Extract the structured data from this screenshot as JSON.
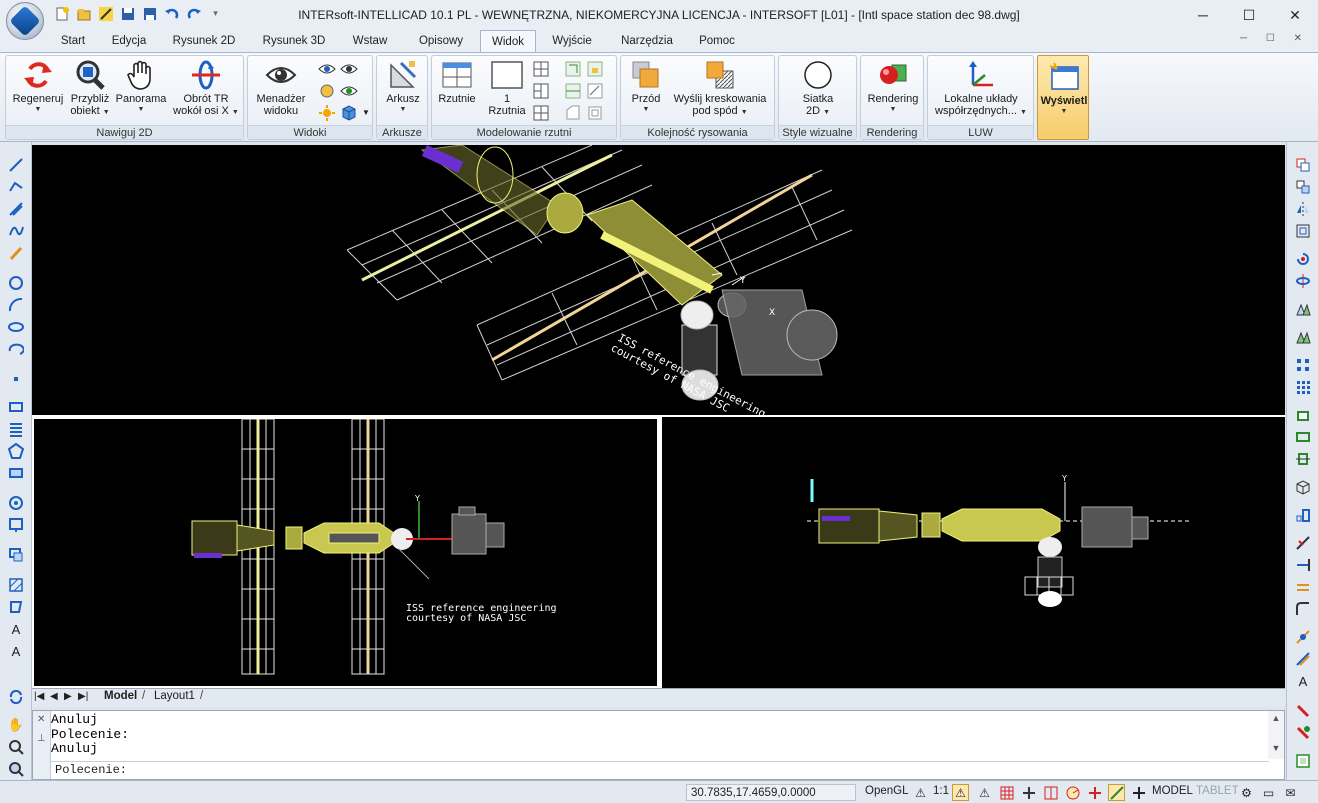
{
  "window": {
    "title": "INTERsoft-INTELLICAD 10.1 PL - WEWNĘTRZNA, NIEKOMERCYJNA LICENCJA - INTERSOFT [L01] - [Intl space station dec 98.dwg]",
    "minimize": "─",
    "maximize": "☐",
    "close": "✕"
  },
  "tabs": [
    {
      "label": "Start"
    },
    {
      "label": "Edycja"
    },
    {
      "label": "Rysunek 2D"
    },
    {
      "label": "Rysunek 3D"
    },
    {
      "label": "Wstaw"
    },
    {
      "label": "Opisowy"
    },
    {
      "label": "Widok",
      "active": true
    },
    {
      "label": "Wyjście"
    },
    {
      "label": "Narzędzia"
    },
    {
      "label": "Pomoc"
    }
  ],
  "ribbon": {
    "groups": {
      "nawiguj": "Nawiguj 2D",
      "widoki": "Widoki",
      "arkusze": "Arkusze",
      "modelowanie": "Modelowanie rzutni",
      "kolejnosc": "Kolejność rysowania",
      "style": "Style wizualne",
      "rendering": "Rendering",
      "luw": "LUW"
    },
    "buttons": {
      "regeneruj": "Regeneruj",
      "przybliz_1": "Przybliż",
      "przybliz_2": "obiekt",
      "panorama": "Panorama",
      "obrot_1": "Obrót TR",
      "obrot_2": "wokół osi X",
      "menadzer_1": "Menadżer",
      "menadzer_2": "widoku",
      "arkusz": "Arkusz",
      "rzutnie": "Rzutnie",
      "rzutnia_1": "1",
      "rzutnia_2": "Rzutnia",
      "przod": "Przód",
      "wyslij_1": "Wyślij kreskowania",
      "wyslij_2": "pod spód",
      "siatka_1": "Siatka",
      "siatka_2": "2D",
      "rendering": "Rendering",
      "lokalne_1": "Lokalne układy",
      "lokalne_2": "współrzędnych...",
      "wyswietl": "Wyświetl"
    }
  },
  "drawing": {
    "annotation_line1": "ISS reference engineering",
    "annotation_line2": "courtesy of NASA JSC",
    "axis_y": "Y",
    "axis_x": "X"
  },
  "layout_tabs": {
    "model": "Model",
    "layout1": "Layout1"
  },
  "command": {
    "history": [
      "Anuluj",
      "Polecenie:",
      "Anuluj"
    ],
    "prompt": "Polecenie:"
  },
  "status": {
    "coords": "30.7835,17.4659,0.0000",
    "renderer": "OpenGL",
    "scale": "1:1",
    "space": "MODEL",
    "tablet": "TABLET"
  },
  "colors": {
    "station": "#f2f27a",
    "panel": "#e8e8e8",
    "module_gray": "#8a8a8a",
    "accent_purple": "#6a2fd0",
    "background": "#000000"
  }
}
